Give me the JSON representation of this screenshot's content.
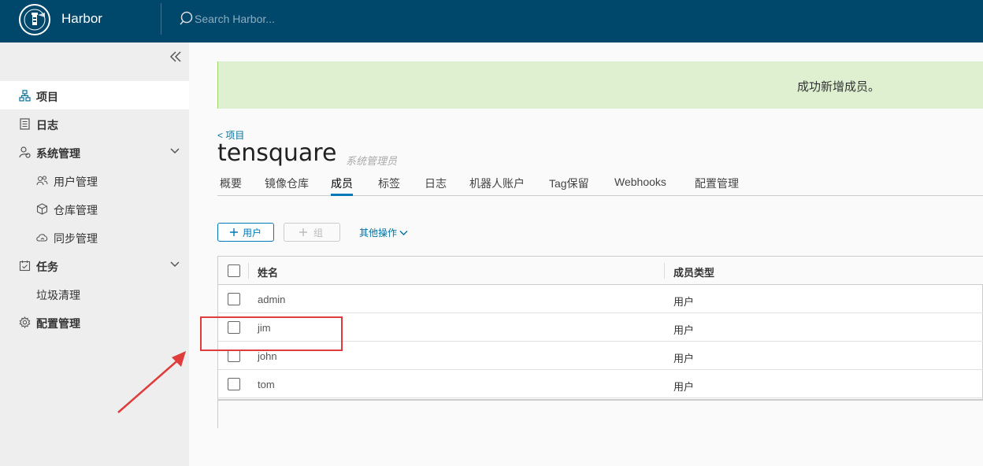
{
  "header": {
    "app_name": "Harbor",
    "search_placeholder": "Search Harbor..."
  },
  "sidebar": {
    "items": [
      {
        "label": "项目",
        "icon": "projects-icon",
        "active": true
      },
      {
        "label": "日志",
        "icon": "logs-icon"
      },
      {
        "label": "系统管理",
        "icon": "admin-icon",
        "expandable": true
      },
      {
        "label": "用户管理",
        "icon": "users-icon",
        "sub": true
      },
      {
        "label": "仓库管理",
        "icon": "registry-icon",
        "sub": true
      },
      {
        "label": "同步管理",
        "icon": "replication-icon",
        "sub": true
      },
      {
        "label": "任务",
        "icon": "tasks-icon",
        "expandable": true
      },
      {
        "label": "垃圾清理",
        "sub": true
      },
      {
        "label": "配置管理",
        "icon": "gear-icon"
      }
    ]
  },
  "alert": {
    "message": "成功新增成员。"
  },
  "breadcrumb": "< 项目",
  "project": {
    "title": "tensquare",
    "role": "系统管理员"
  },
  "tabs": [
    "概要",
    "镜像仓库",
    "成员",
    "标签",
    "日志",
    "机器人账户",
    "Tag保留",
    "Webhooks",
    "配置管理"
  ],
  "active_tab": "成员",
  "toolbar": {
    "add_user": "用户",
    "add_group": "组",
    "more_actions": "其他操作"
  },
  "members_table": {
    "columns": [
      "姓名",
      "成员类型"
    ],
    "rows": [
      {
        "name": "admin",
        "type": "用户"
      },
      {
        "name": "jim",
        "type": "用户"
      },
      {
        "name": "john",
        "type": "用户"
      },
      {
        "name": "tom",
        "type": "用户"
      }
    ]
  },
  "colors": {
    "header_bg": "#00476c",
    "accent": "#0079b8",
    "alert_bg": "#dff0d0",
    "annotation": "#e03c3c"
  }
}
